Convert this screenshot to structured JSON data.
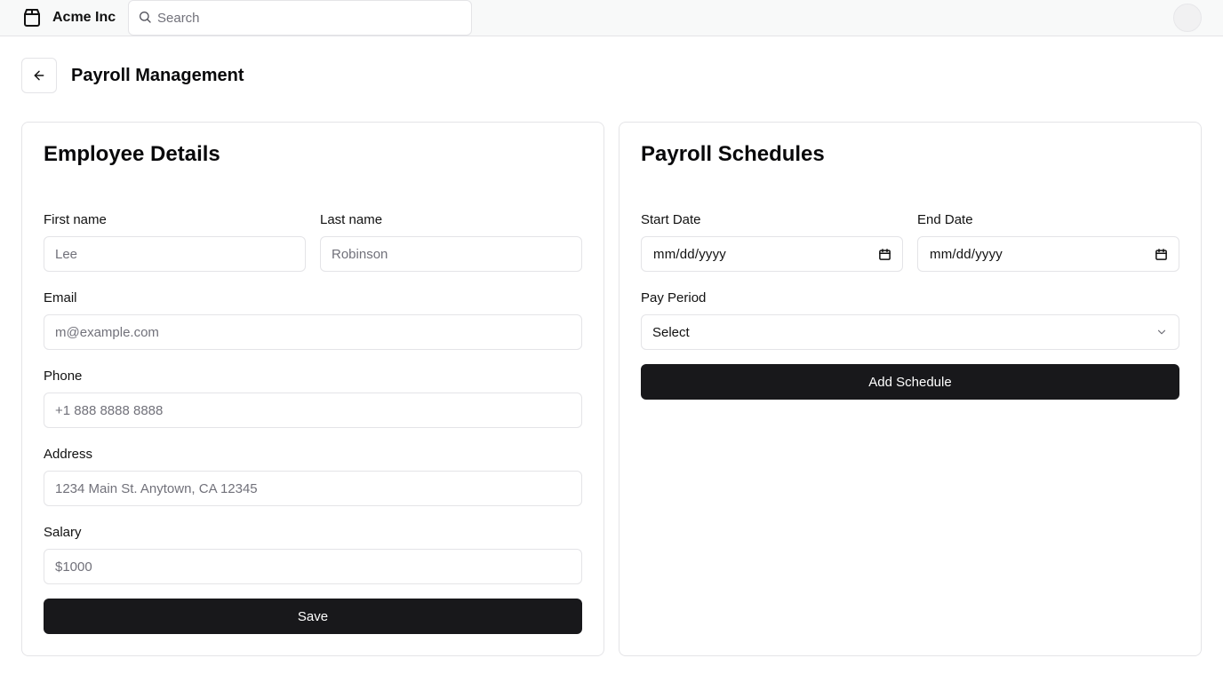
{
  "header": {
    "brand_name": "Acme Inc",
    "brand_icon": "package-icon",
    "search_placeholder": "Search",
    "search_icon": "search-icon"
  },
  "page": {
    "title": "Payroll Management",
    "back_icon": "arrow-left-icon"
  },
  "employee_details": {
    "title": "Employee Details",
    "first_name_label": "First name",
    "first_name_placeholder": "Lee",
    "last_name_label": "Last name",
    "last_name_placeholder": "Robinson",
    "email_label": "Email",
    "email_placeholder": "m@example.com",
    "phone_label": "Phone",
    "phone_placeholder": "+1 888 8888 8888",
    "address_label": "Address",
    "address_placeholder": "1234 Main St. Anytown, CA 12345",
    "salary_label": "Salary",
    "salary_placeholder": "$1000",
    "save_label": "Save"
  },
  "payroll_schedules": {
    "title": "Payroll Schedules",
    "start_date_label": "Start Date",
    "start_date_value": "mm/dd/yyyy",
    "end_date_label": "End Date",
    "end_date_value": "mm/dd/yyyy",
    "pay_period_label": "Pay Period",
    "pay_period_value": "Select",
    "add_schedule_label": "Add Schedule"
  },
  "colors": {
    "primary_button": "#18181b",
    "border": "#e4e4e7",
    "header_bg": "#f8f9f9",
    "placeholder": "#71717a"
  }
}
